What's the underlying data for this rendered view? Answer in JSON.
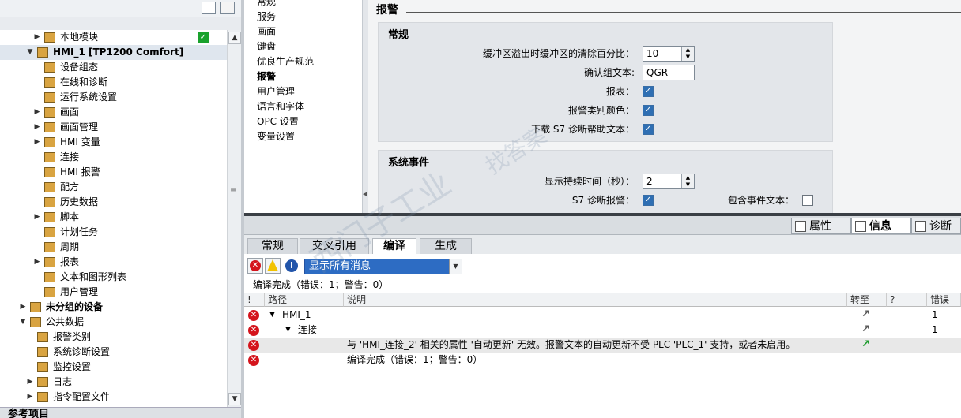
{
  "tree": {
    "items": [
      {
        "label": "本地模块",
        "level": 2,
        "arrow": "▶",
        "icon": "folder-icon",
        "ok": true
      },
      {
        "label": "HMI_1 [TP1200 Comfort]",
        "level": 1,
        "arrow": "▼",
        "icon": "hmi-device-icon",
        "bold": true,
        "selected": true
      },
      {
        "label": "设备组态",
        "level": 2,
        "arrow": "",
        "icon": "device-config-icon"
      },
      {
        "label": "在线和诊断",
        "level": 2,
        "arrow": "",
        "icon": "online-diagnostics-icon"
      },
      {
        "label": "运行系统设置",
        "level": 2,
        "arrow": "",
        "icon": "runtime-settings-icon"
      },
      {
        "label": "画面",
        "level": 2,
        "arrow": "▶",
        "icon": "folder-icon"
      },
      {
        "label": "画面管理",
        "level": 2,
        "arrow": "▶",
        "icon": "screen-management-icon"
      },
      {
        "label": "HMI 变量",
        "level": 2,
        "arrow": "▶",
        "icon": "hmi-tags-icon"
      },
      {
        "label": "连接",
        "level": 2,
        "arrow": "",
        "icon": "connection-icon"
      },
      {
        "label": "HMI 报警",
        "level": 2,
        "arrow": "",
        "icon": "hmi-alarms-icon"
      },
      {
        "label": "配方",
        "level": 2,
        "arrow": "",
        "icon": "recipe-icon"
      },
      {
        "label": "历史数据",
        "level": 2,
        "arrow": "",
        "icon": "historical-data-icon"
      },
      {
        "label": "脚本",
        "level": 2,
        "arrow": "▶",
        "icon": "script-icon"
      },
      {
        "label": "计划任务",
        "level": 2,
        "arrow": "",
        "icon": "scheduled-task-icon"
      },
      {
        "label": "周期",
        "level": 2,
        "arrow": "",
        "icon": "cycle-icon"
      },
      {
        "label": "报表",
        "level": 2,
        "arrow": "▶",
        "icon": "report-icon"
      },
      {
        "label": "文本和图形列表",
        "level": 2,
        "arrow": "",
        "icon": "text-graphic-list-icon"
      },
      {
        "label": "用户管理",
        "level": 2,
        "arrow": "",
        "icon": "user-management-icon"
      },
      {
        "label": "未分组的设备",
        "level": 0,
        "arrow": "▶",
        "icon": "ungrouped-devices-icon",
        "bold": true
      },
      {
        "label": "公共数据",
        "level": 0,
        "arrow": "▼",
        "icon": "common-data-icon"
      },
      {
        "label": "报警类别",
        "level": 1,
        "arrow": "",
        "icon": "alarm-class-icon"
      },
      {
        "label": "系统诊断设置",
        "level": 1,
        "arrow": "",
        "icon": "system-diagnostics-icon"
      },
      {
        "label": "监控设置",
        "level": 1,
        "arrow": "",
        "icon": "monitoring-icon"
      },
      {
        "label": "日志",
        "level": 1,
        "arrow": "▶",
        "icon": "log-icon"
      },
      {
        "label": "指令配置文件",
        "level": 1,
        "arrow": "▶",
        "icon": "instruction-profile-icon"
      }
    ],
    "reference_label": "参考项目"
  },
  "nav": {
    "items": [
      "常规",
      "服务",
      "画面",
      "键盘",
      "优良生产规范",
      "报警",
      "用户管理",
      "语言和字体",
      "OPC 设置",
      "变量设置"
    ],
    "selected_index": 5
  },
  "content": {
    "heading": "报警",
    "general": {
      "title": "常规",
      "buffer_label": "缓冲区溢出时缓冲区的清除百分比：",
      "buffer_value": "10",
      "ack_label": "确认组文本:",
      "ack_value": "QGR",
      "report_label": "报表：",
      "color_label": "报警类别颜色：",
      "download_label": "下载 S7 诊断帮助文本："
    },
    "sysevents": {
      "title": "系统事件",
      "duration_label": "显示持续时间（秒）：",
      "duration_value": "2",
      "s7_label": "S7 诊断报警：",
      "eventtext_label": "包含事件文本："
    }
  },
  "inspector": {
    "right_tabs": [
      "属性",
      "信息",
      "诊断"
    ],
    "active_right_tab": 1,
    "sub_tabs": [
      "常规",
      "交叉引用",
      "编译",
      "生成"
    ],
    "active_sub_tab": 2,
    "filter_value": "显示所有消息",
    "summary": "编译完成（错误：1；警告：0）",
    "columns": [
      "!",
      "路径",
      "说明",
      "转至",
      "?",
      "错误"
    ],
    "rows": [
      {
        "path": "HMI_1",
        "indent": 0,
        "expand": "▼",
        "desc": "",
        "goto": true,
        "errors": "1"
      },
      {
        "path": "连接",
        "indent": 1,
        "expand": "▼",
        "desc": "",
        "goto": true,
        "errors": "1"
      },
      {
        "path": "",
        "indent": 2,
        "expand": "",
        "desc": "与 'HMI_连接_2' 相关的属性 '自动更新' 无效。报警文本的自动更新不受 PLC 'PLC_1' 支持，或者未启用。",
        "goto": true,
        "errors": "",
        "highlight": true
      },
      {
        "path": "",
        "indent": 2,
        "expand": "",
        "desc": "编译完成（错误：1；警告：0）",
        "goto": false,
        "errors": ""
      }
    ]
  },
  "colors": {
    "accent": "#2d6cc3",
    "error": "#d4141c",
    "ok": "#1aa22d"
  }
}
